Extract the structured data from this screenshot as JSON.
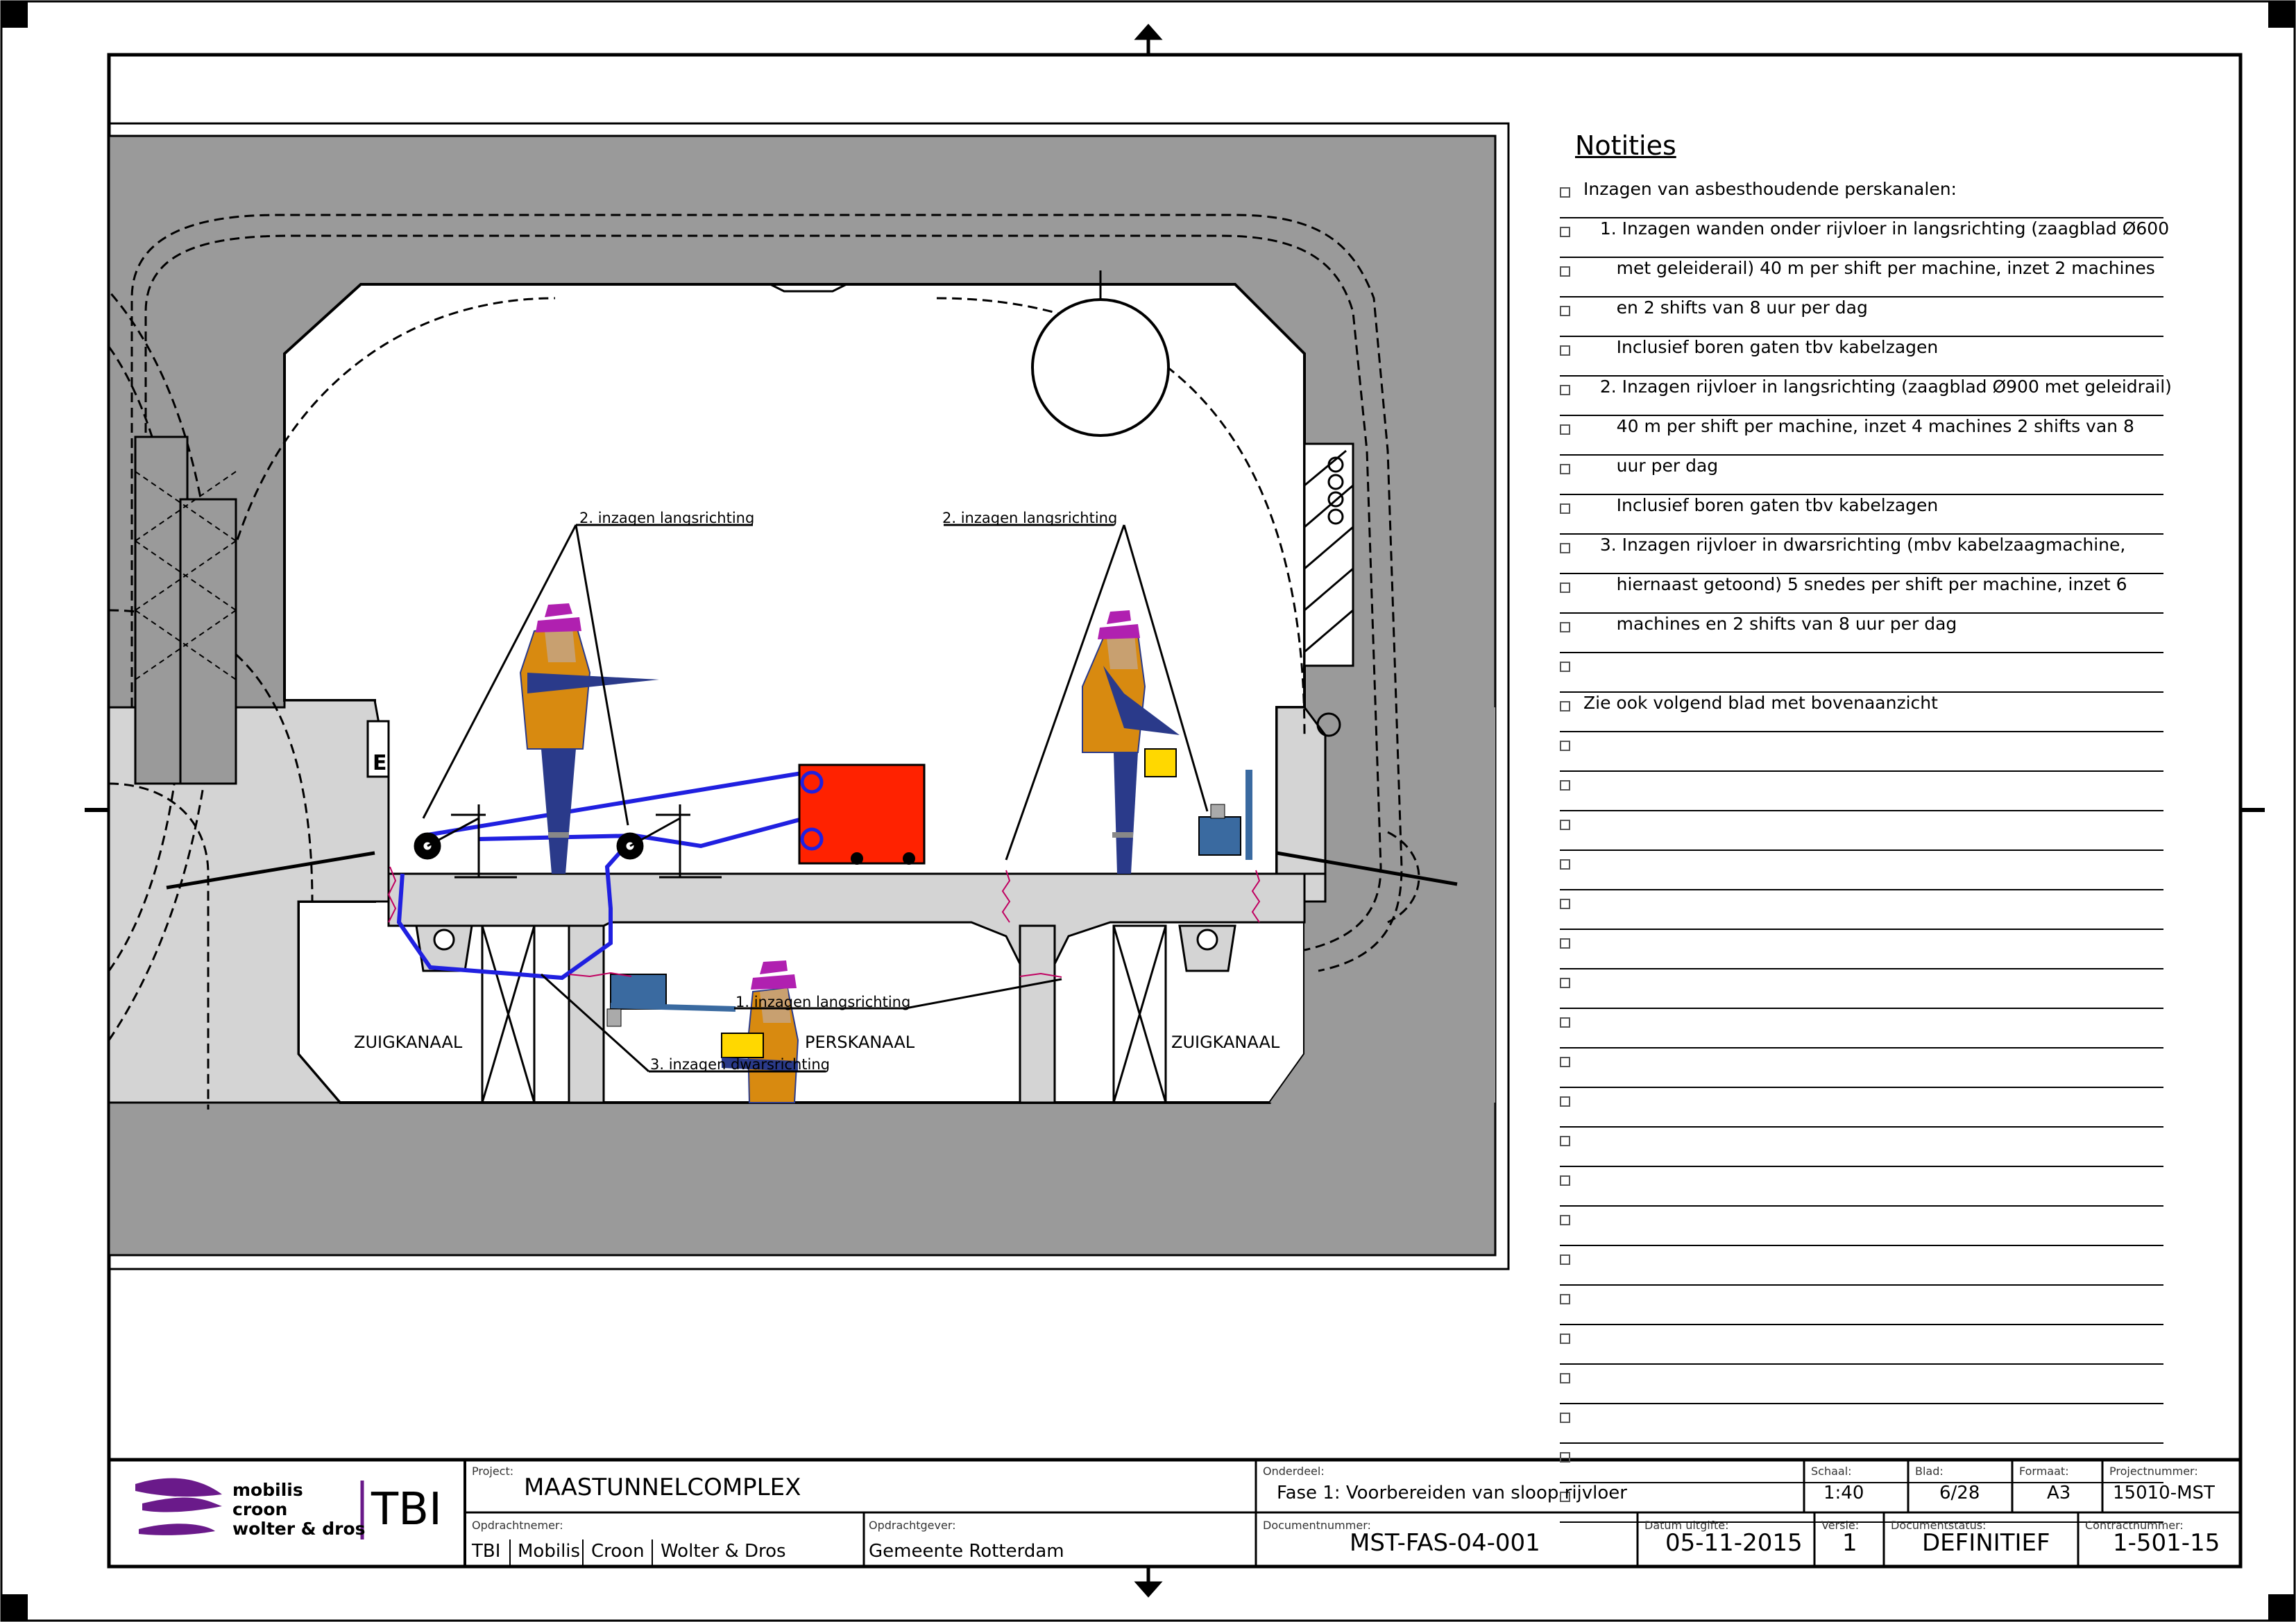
{
  "drawing": {
    "labels": {
      "langs_left": "2. inzagen langsrichting",
      "langs_right": "2. inzagen langsrichting",
      "langs_bottom": "1. inzagen langsrichting",
      "dwars": "3. inzagen dwarsrichting",
      "zuig_left": "ZUIGKANAAL",
      "pers": "PERSKANAAL",
      "zuig_right": "ZUIGKANAAL"
    },
    "colors": {
      "worker_orange": "#d88a10",
      "worker_blue": "#2a3a8a",
      "helmet": "#b020b0",
      "skin": "#c8a070",
      "machine_red": "#ff2200",
      "saw_blue": "#3a6aa0",
      "cable_blue": "#2020e0",
      "concrete": "#d4d4d4",
      "ground": "#9a9a9a",
      "toolbox": "#ffd800"
    }
  },
  "notes": {
    "title": "Notities",
    "rows": [
      "Inzagen van asbesthoudende perskanalen:",
      "   1. Inzagen wanden onder rijvloer in langsrichting (zaagblad Ø600",
      "      met geleiderail) 40 m per shift per machine, inzet 2 machines",
      "      en 2 shifts van 8 uur per dag",
      "      Inclusief boren gaten tbv kabelzagen",
      "   2. Inzagen rijvloer in langsrichting (zaagblad Ø900 met geleidrail)",
      "      40 m per shift per machine, inzet 4 machines 2 shifts van 8",
      "      uur per dag",
      "      Inclusief boren gaten tbv kabelzagen",
      "   3. Inzagen rijvloer in dwarsrichting (mbv kabelzaagmachine,",
      "      hiernaast getoond) 5 snedes per shift per machine, inzet 6",
      "      machines en 2 shifts van 8 uur per dag",
      "",
      "Zie ook volgend blad met bovenaanzicht",
      "",
      "",
      "",
      "",
      "",
      "",
      "",
      "",
      "",
      "",
      "",
      "",
      "",
      "",
      "",
      "",
      "",
      "",
      "",
      ""
    ]
  },
  "titleblock": {
    "logo_text": [
      "mobilis",
      "croon",
      "wolter & dros"
    ],
    "logo_brand": "TBI",
    "project_label": "Project:",
    "project": "MAASTUNNELCOMPLEX",
    "onderdeel_label": "Onderdeel:",
    "onderdeel": "Fase 1: Voorbereiden van sloop rijvloer",
    "schaal_label": "Schaal:",
    "schaal": "1:40",
    "blad_label": "Blad:",
    "blad": "6/28",
    "formaat_label": "Formaat:",
    "formaat": "A3",
    "projectnummer_label": "Projectnummer:",
    "projectnummer": "15010-MST",
    "opdrachtnemer_label": "Opdrachtnemer:",
    "opdrachtnemer": [
      "TBI",
      "Mobilis",
      "Croon",
      "Wolter & Dros"
    ],
    "opdrachtgever_label": "Opdrachtgever:",
    "opdrachtgever": "Gemeente Rotterdam",
    "documentnummer_label": "Documentnummer:",
    "documentnummer": "MST-FAS-04-001",
    "datum_label": "Datum uitgifte:",
    "datum": "05-11-2015",
    "versie_label": "Versie:",
    "versie": "1",
    "status_label": "Documentstatus:",
    "status": "DEFINITIEF",
    "contract_label": "Contractnummer:",
    "contract": "1-501-15"
  }
}
